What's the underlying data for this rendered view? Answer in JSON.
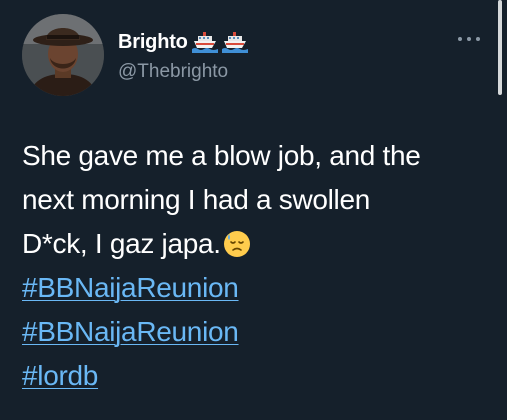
{
  "author": {
    "display_name": "Brighto",
    "handle": "@Thebrighto",
    "name_badges": [
      "ship-icon",
      "ship-icon"
    ]
  },
  "tweet": {
    "lines": [
      "She gave me a blow job, and the",
      "next morning I had a swollen",
      "D*ck, I gaz japa."
    ],
    "emoji": "downcast-face-with-sweat",
    "hashtags": [
      "#BBNaijaReunion",
      "#BBNaijaReunion",
      "#lordb"
    ]
  },
  "colors": {
    "background": "#15202b",
    "text": "#ffffff",
    "secondary_text": "#8b98a5",
    "link": "#6ab8f5"
  }
}
